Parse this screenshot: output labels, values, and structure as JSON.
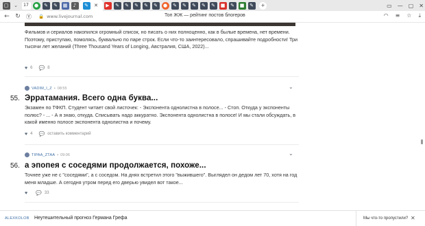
{
  "browser": {
    "tab_badge": "17",
    "url": "www.livejournal.com",
    "title": "Топ ЖЖ — рейтинг постов блогеров",
    "colors": {
      "tabstrip": "#e9e9ea",
      "accent": "#3b6ea5"
    }
  },
  "feed": {
    "prev_post": {
      "text": "Фильмов и сериалов накопился огромный список, но писать о них полноценно, как в былые времена, нет времени. Поэтому, приступаю, помолясь, буквально по паре строк. Если что-то заинтересовало, спрашивайте подробности! Три тысячи лет желаний (Three Thousand Years of Longing, Австралия, США, 2022)...",
      "likes": "6",
      "comments": "8"
    },
    "posts": [
      {
        "rank": "55.",
        "author": "VADIM_I_Z",
        "time": "08:55",
        "title": "Эрратамания. Всего одна буква...",
        "text": "Экзамен по ТФКП. Студент читает свой листочек: - Экспонента однолистна в полосе... - Стоп. Откуда у экспоненты полюс? - ... - А я знаю, откуда. Списывать надо аккуратно. Экспонента однолистна в полосе! И мы стали обсуждать, в какой именно полосе экспонента однолистна и почему.",
        "likes": "4",
        "comments_label": "оставить комментарий"
      },
      {
        "rank": "56.",
        "author": "TIPAA_ZTAA",
        "time": "09:06",
        "title": "а эпопея с соседями продолжается, похоже...",
        "text": "Точнее уже не с \"соседями\", а с соседом. На днях встретил этого \"выжившего\". Выглядел он дедом лет 70, хотя на год меня младше. А сегодня утром перед его дверью увидел вот такое...",
        "comments": "33"
      }
    ]
  },
  "bottom_bar": {
    "author": "ALEXKOLOB",
    "title": "Неутешительный прогноз Германа Грефа",
    "missed": "Мы что-то пропустили?"
  }
}
